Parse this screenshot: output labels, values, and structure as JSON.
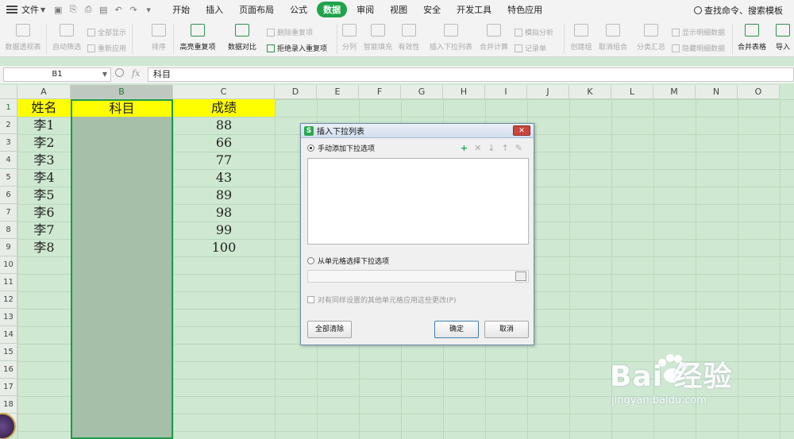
{
  "menubar": {
    "file_label": "文件",
    "tabs": [
      {
        "label": "开始",
        "active": false
      },
      {
        "label": "插入",
        "active": false
      },
      {
        "label": "页面布局",
        "active": false
      },
      {
        "label": "公式",
        "active": false
      },
      {
        "label": "数据",
        "active": true
      },
      {
        "label": "审阅",
        "active": false
      },
      {
        "label": "视图",
        "active": false
      },
      {
        "label": "安全",
        "active": false
      },
      {
        "label": "开发工具",
        "active": false
      },
      {
        "label": "特色应用",
        "active": false
      }
    ],
    "search_label": "查找命令、搜索模板"
  },
  "ribbon": {
    "pivot": "数据透视表",
    "autofilter": "自动筛选",
    "show_all": "全部显示",
    "reapply": "重新应用",
    "sort": "排序",
    "highlight_dup": "高亮重复项",
    "compare": "数据对比",
    "delete_dup": "删除重复项",
    "reject_dup": "拒绝录入重复项",
    "split": "分列",
    "smart_fill": "智能填充",
    "validity": "有效性",
    "insert_dropdown": "插入下拉列表",
    "merge_calc": "合并计算",
    "simulate": "模拟分析",
    "record": "记录单",
    "create_group": "创建组",
    "ungroup": "取消组合",
    "subtotal": "分类汇总",
    "show_detail": "显示明细数据",
    "hide_detail": "隐藏明细数据",
    "merge_table": "合并表格",
    "import": "导入"
  },
  "formula_bar": {
    "name_box": "B1",
    "fx": "fx",
    "content": "科目"
  },
  "sheet": {
    "columns": [
      "A",
      "B",
      "C",
      "D",
      "E",
      "F",
      "G",
      "H",
      "I",
      "J",
      "K",
      "L",
      "M",
      "N",
      "O"
    ],
    "rows": [
      "1",
      "2",
      "3",
      "4",
      "5",
      "6",
      "7",
      "8",
      "9",
      "10",
      "11",
      "12",
      "13",
      "14",
      "15",
      "16",
      "17",
      "18",
      "19"
    ],
    "header": {
      "a": "姓名",
      "b": "科目",
      "c": "成绩"
    },
    "data": [
      {
        "name": "李1",
        "score": "88"
      },
      {
        "name": "李2",
        "score": "66"
      },
      {
        "name": "李3",
        "score": "77"
      },
      {
        "name": "李4",
        "score": "43"
      },
      {
        "name": "李5",
        "score": "89"
      },
      {
        "name": "李6",
        "score": "98"
      },
      {
        "name": "李7",
        "score": "99"
      },
      {
        "name": "李8",
        "score": "100"
      }
    ]
  },
  "dialog": {
    "title": "插入下拉列表",
    "manual_option": "手动添加下拉选项",
    "cell_option": "从单元格选择下拉选项",
    "apply_same": "对有同样设置的其他单元格应用这些更改(P)",
    "clear_all": "全部清除",
    "ok": "确定",
    "cancel": "取消"
  },
  "watermark": {
    "brand": "Bai  经验",
    "url": "jingyan.baidu.com"
  },
  "colors": {
    "accent": "#1fa44b",
    "header_yellow": "#ffff00",
    "grid_bg": "#cfe8d1"
  }
}
